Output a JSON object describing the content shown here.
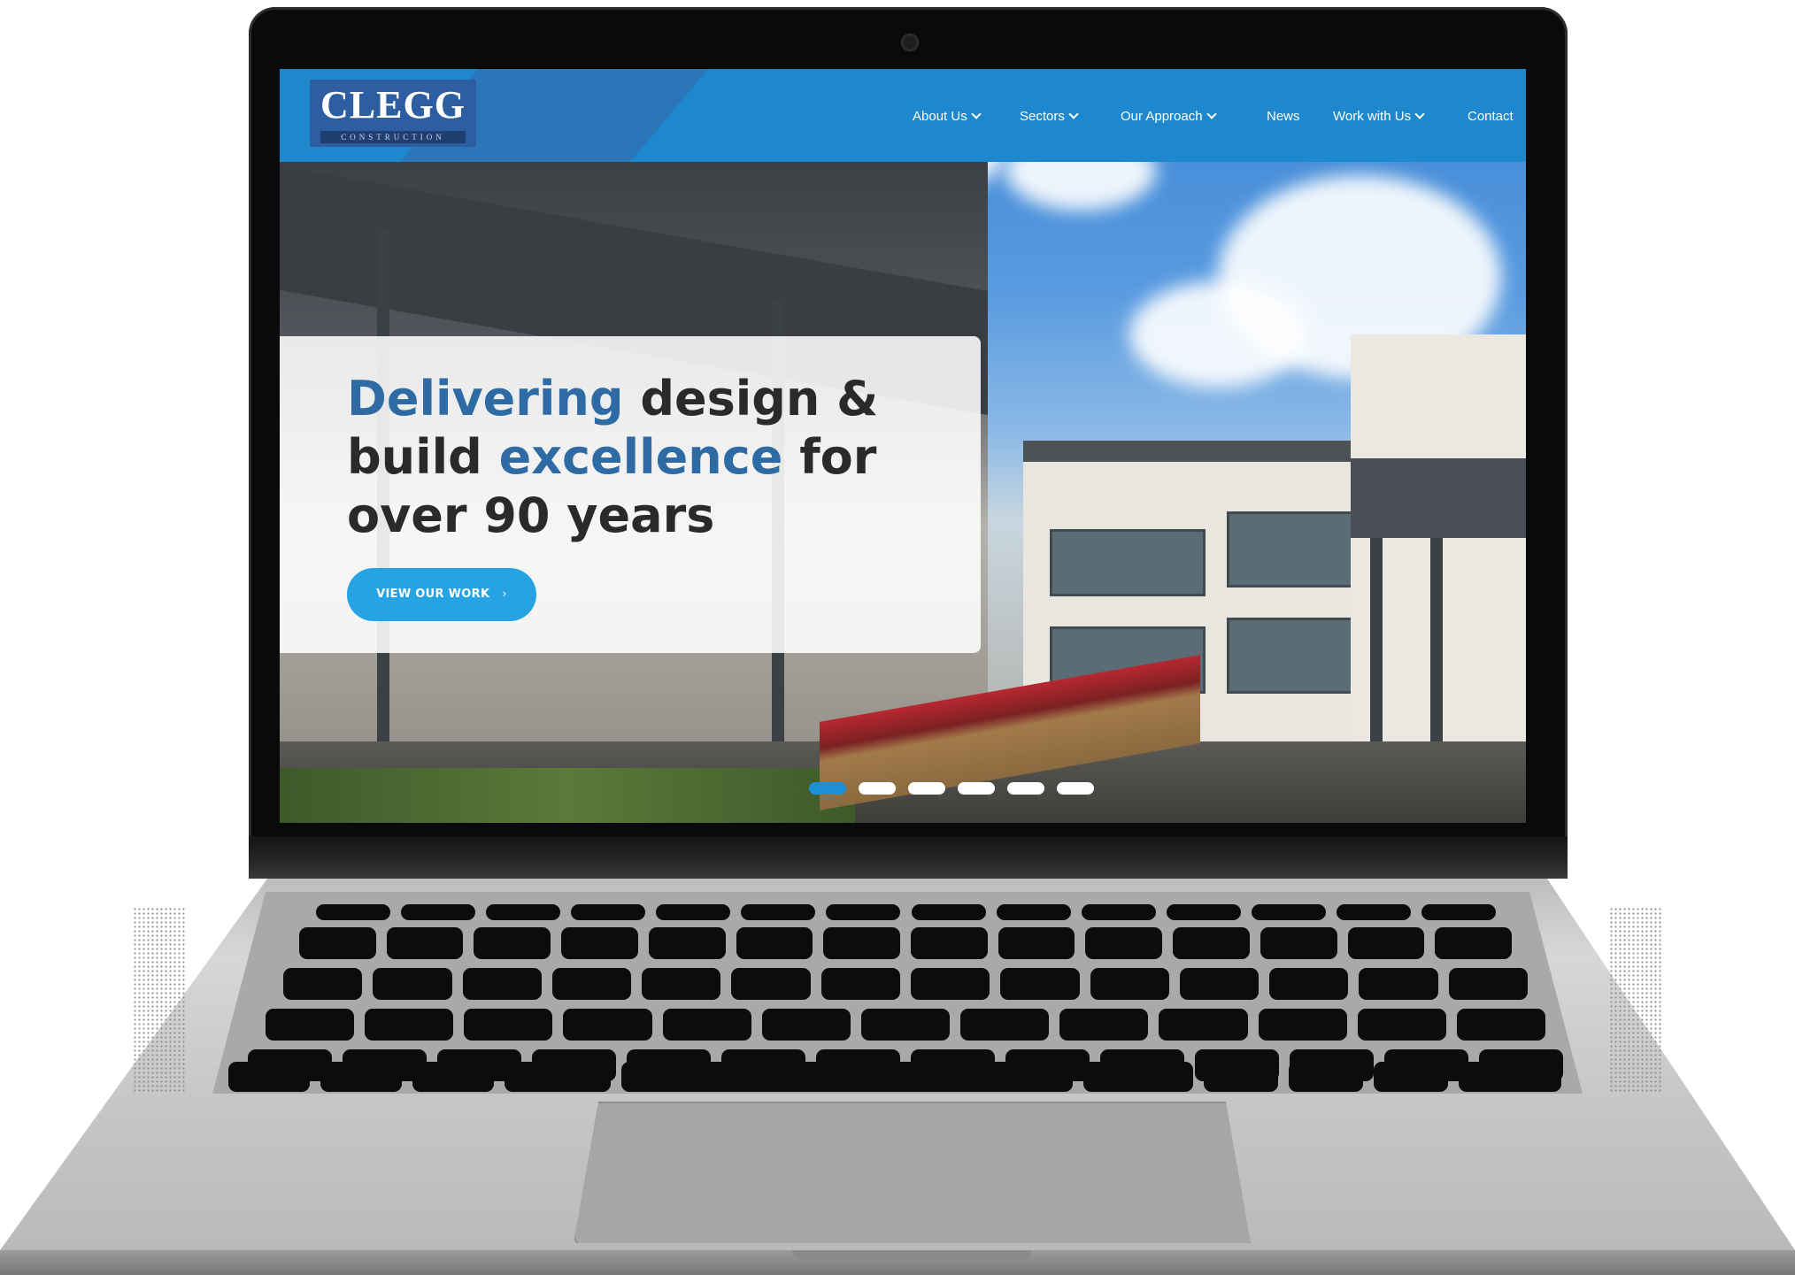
{
  "site": {
    "brand": "CLEGG",
    "brand_sub": "CONSTRUCTION",
    "nav": [
      {
        "label": "About Us",
        "dropdown": true
      },
      {
        "label": "Sectors",
        "dropdown": true
      },
      {
        "label": "Our Approach",
        "dropdown": true
      },
      {
        "label": "News",
        "dropdown": false
      },
      {
        "label": "Work with Us",
        "dropdown": true
      },
      {
        "label": "Contact",
        "dropdown": false
      }
    ]
  },
  "hero": {
    "headline_parts": [
      {
        "text": "Delivering",
        "accent": true
      },
      {
        "text": " design & ",
        "accent": false
      },
      {
        "text": "build ",
        "accent": false
      },
      {
        "text": "excellence",
        "accent": true
      },
      {
        "text": " for ",
        "accent": false
      },
      {
        "text": "over 90 years",
        "accent": false
      }
    ],
    "cta_label": "VIEW OUR WORK",
    "cta_arrow": "›"
  },
  "slider": {
    "slide_count": 6,
    "active_index": 0
  },
  "colors": {
    "header_blue": "#1d88cd",
    "headline_accent": "#2e6aa3",
    "cta_blue": "#26a3e3",
    "dot_active": "#1e8fd6"
  },
  "icons": {
    "dropdown": "chevron-down-icon",
    "cta": "chevron-right-icon"
  }
}
